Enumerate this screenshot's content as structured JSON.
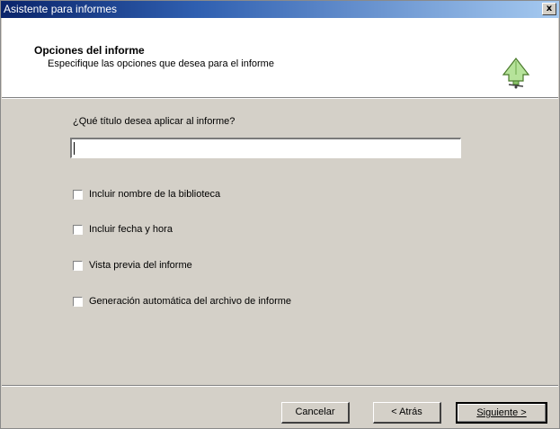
{
  "window": {
    "title": "Asistente para informes",
    "close_label": "x"
  },
  "header": {
    "title": "Opciones del informe",
    "subtitle": "Especifique las opciones que desea para el informe",
    "icon": "wizard-bell-icon"
  },
  "form": {
    "question": "¿Qué título desea aplicar al informe?",
    "title_value": "",
    "options": [
      {
        "label": "Incluir nombre de la biblioteca",
        "checked": false
      },
      {
        "label": "Incluir fecha y hora",
        "checked": false
      },
      {
        "label": "Vista previa del informe",
        "checked": false
      },
      {
        "label": "Generación automática del archivo de informe",
        "checked": false
      }
    ]
  },
  "buttons": {
    "cancel": "Cancelar",
    "back": "< Atrás",
    "next": "Siguiente >"
  }
}
